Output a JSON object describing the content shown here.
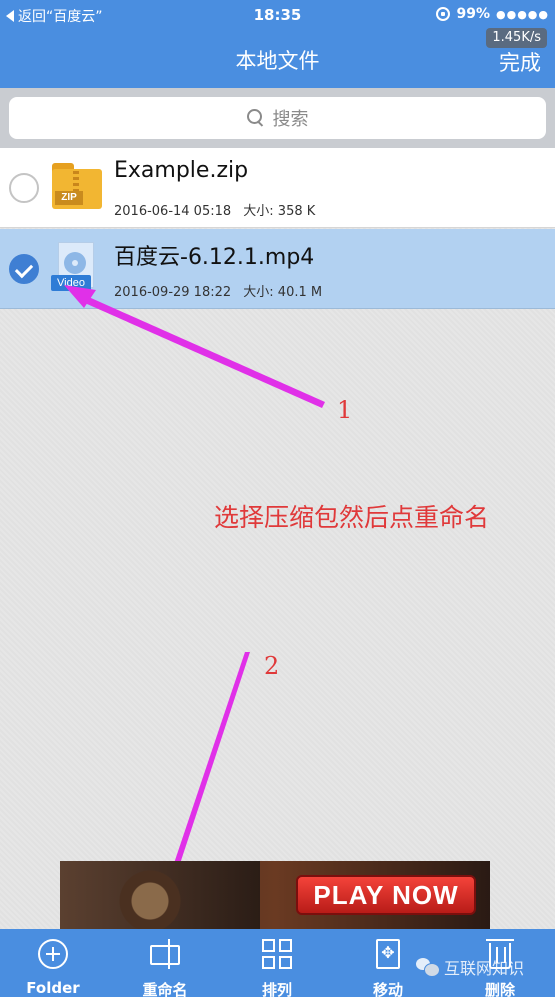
{
  "status_bar": {
    "back_label": "返回“百度云”",
    "time": "18:35",
    "battery": "99%",
    "signal": "●●●●●"
  },
  "nav": {
    "title": "本地文件",
    "done_label": "完成",
    "speed": "1.45K/s"
  },
  "search": {
    "placeholder": "搜索"
  },
  "files": [
    {
      "name": "Example.zip",
      "date": "2016-06-14 05:18",
      "size": "大小: 358 K",
      "type_label": "ZIP",
      "selected": false
    },
    {
      "name": "百度云-6.12.1.mp4",
      "date": "2016-09-29 18:22",
      "size": "大小: 40.1 M",
      "type_label": "Video",
      "selected": true
    }
  ],
  "annotations": {
    "step1": "1",
    "instruction": "选择压缩包然后点重命名",
    "step2": "2",
    "color": "#e0393a",
    "arrow_color": "#e030e8"
  },
  "ad": {
    "cta": "PLAY NOW"
  },
  "toolbar": {
    "folder_label": "Folder",
    "rename_label": "重命名",
    "sort_label": "排列",
    "move_label": "移动",
    "delete_label": "删除"
  },
  "watermark": "互联网知识",
  "colors": {
    "primary": "#4a8ee0",
    "selected_row": "#b2d1f1",
    "zip_folder": "#f2b632"
  }
}
